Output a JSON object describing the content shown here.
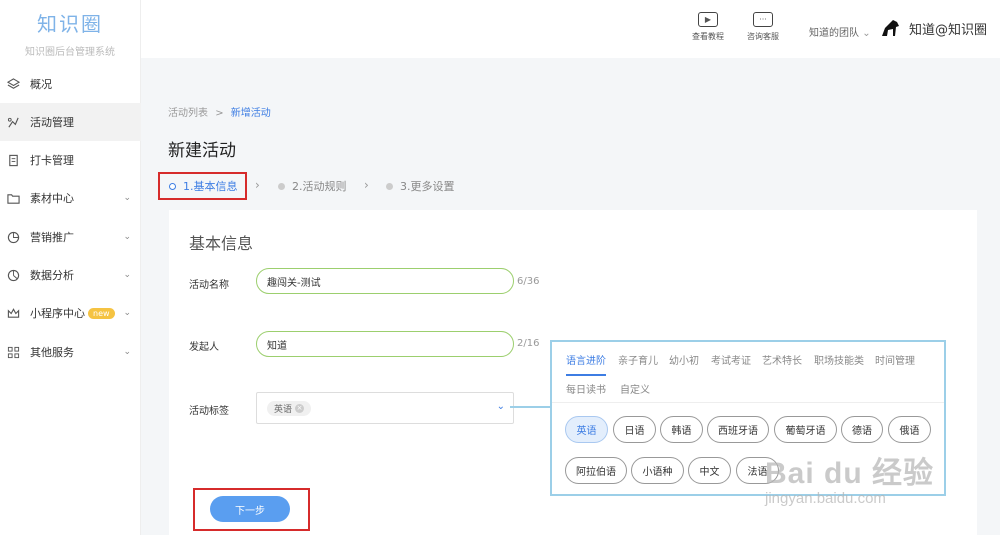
{
  "app": {
    "logo_title": "知识圈",
    "logo_subtitle": "知识圈后台管理系统"
  },
  "sidebar": {
    "items": [
      {
        "label": "概况",
        "icon": "layers-icon"
      },
      {
        "label": "活动管理",
        "icon": "activity-icon"
      },
      {
        "label": "打卡管理",
        "icon": "clipboard-icon"
      },
      {
        "label": "素材中心",
        "icon": "folder-icon"
      },
      {
        "label": "营销推广",
        "icon": "marketing-icon"
      },
      {
        "label": "数据分析",
        "icon": "pie-chart-icon"
      },
      {
        "label": "小程序中心",
        "icon": "crown-icon",
        "badge": "new"
      },
      {
        "label": "其他服务",
        "icon": "grid-icon"
      }
    ],
    "active": "活动管理"
  },
  "header": {
    "tutorial_label": "查看教程",
    "support_label": "咨询客服",
    "team_label": "知道的团队",
    "username": "知道@知识圈"
  },
  "breadcrumb": {
    "parent": "活动列表",
    "separator": ">",
    "current": "新增活动"
  },
  "page": {
    "title": "新建活动"
  },
  "steps": [
    {
      "label": "1.基本信息",
      "active": true
    },
    {
      "label": "2.活动规则",
      "active": false
    },
    {
      "label": "3.更多设置",
      "active": false
    }
  ],
  "form": {
    "section_title": "基本信息",
    "name_label": "活动名称",
    "name_value": "趣闯关-测试",
    "name_count": "6/36",
    "initiator_label": "发起人",
    "initiator_value": "知道",
    "initiator_count": "2/16",
    "tag_label": "活动标签",
    "selected_tag": "英语",
    "next_button": "下一步"
  },
  "tag_dropdown": {
    "tabs": [
      "语言进阶",
      "亲子育儿",
      "幼小初",
      "考试考证",
      "艺术特长",
      "职场技能类",
      "时间管理",
      "每日读书",
      "自定义"
    ],
    "active_tab": "语言进阶",
    "tags": [
      "英语",
      "日语",
      "韩语",
      "西班牙语",
      "葡萄牙语",
      "德语",
      "俄语",
      "阿拉伯语",
      "小语种",
      "中文",
      "法语"
    ],
    "selected": "英语"
  },
  "watermark": {
    "main": "Bai du 经验",
    "sub": "jingyan.baidu.com"
  },
  "colors": {
    "accent": "#3d7de3",
    "highlight_frame": "#d62b2b",
    "input_border": "#9ccf6e",
    "dropdown_border": "#9ccfe8"
  }
}
